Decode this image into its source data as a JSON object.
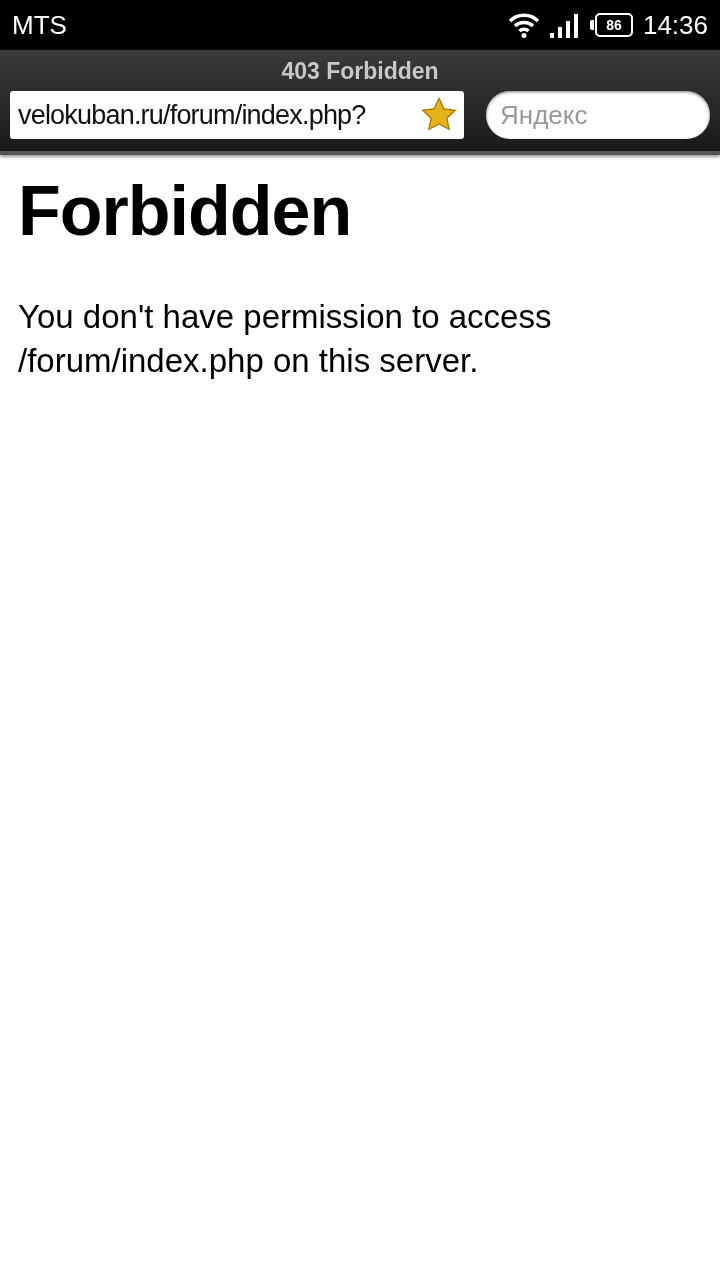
{
  "status_bar": {
    "carrier": "MTS",
    "battery": "86",
    "time": "14:36"
  },
  "browser": {
    "title": "403 Forbidden",
    "url": "velokuban.ru/forum/index.php?",
    "search": {
      "placeholder": "Яндекс"
    }
  },
  "page": {
    "heading": "Forbidden",
    "message": "You don't have permission to access /forum/index.php on this server."
  }
}
